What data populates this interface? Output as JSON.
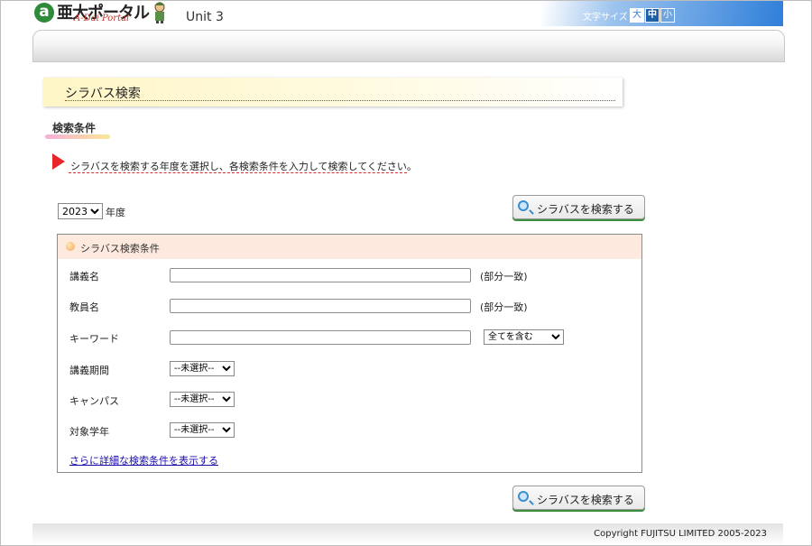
{
  "header": {
    "logo_letter": "a",
    "logo_main": "亜大ポータル",
    "logo_sub": "A-Dai Portal",
    "unit": "Unit 3",
    "font_size_label": "文字サイズ",
    "font_sizes": [
      "大",
      "中",
      "小"
    ]
  },
  "page": {
    "title": "シラバス検索",
    "section_heading": "検索条件",
    "instruction": "シラバスを検索する年度を選択し、各検索条件を入力して検索してください。",
    "year_value": "2023",
    "year_suffix": "年度",
    "search_button": "シラバスを検索する"
  },
  "criteria": {
    "title": "シラバス検索条件",
    "course_name_label": "講義名",
    "course_name_value": "",
    "course_name_hint": "(部分一致)",
    "teacher_label": "教員名",
    "teacher_value": "",
    "teacher_hint": "(部分一致)",
    "keyword_label": "キーワード",
    "keyword_value": "",
    "keyword_mode": "全てを含む",
    "period_label": "講義期間",
    "period_value": "--未選択--",
    "campus_label": "キャンパス",
    "campus_value": "--未選択--",
    "grade_label": "対象学年",
    "grade_value": "--未選択--",
    "more_link": "さらに詳細な検索条件を表示する"
  },
  "footer": {
    "copyright": "Copyright FUJITSU LIMITED 2005-2023"
  },
  "colors": {
    "accent_blue": "#2f7fd9",
    "logo_green": "#2e8b3a",
    "criteria_header": "#fde9de",
    "button_shadow_green": "#3a8f3f"
  }
}
